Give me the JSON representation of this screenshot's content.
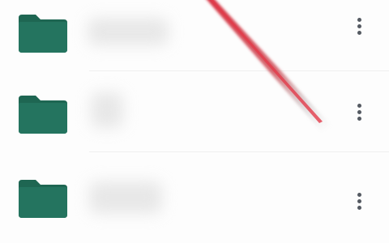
{
  "file_list": {
    "rows": [
      {
        "icon": "folder-icon",
        "name_redacted": true,
        "menu_icon": "more-vert-icon"
      },
      {
        "icon": "folder-icon",
        "name_redacted": true,
        "menu_icon": "more-vert-icon"
      },
      {
        "icon": "folder-icon",
        "name_redacted": true,
        "menu_icon": "more-vert-icon"
      }
    ]
  },
  "colors": {
    "folder": "#24745f",
    "folder_tab": "#1e6652",
    "menu_dots": "#555a62",
    "swipe_streak": "#d62838",
    "background": "#fdfdfd"
  }
}
